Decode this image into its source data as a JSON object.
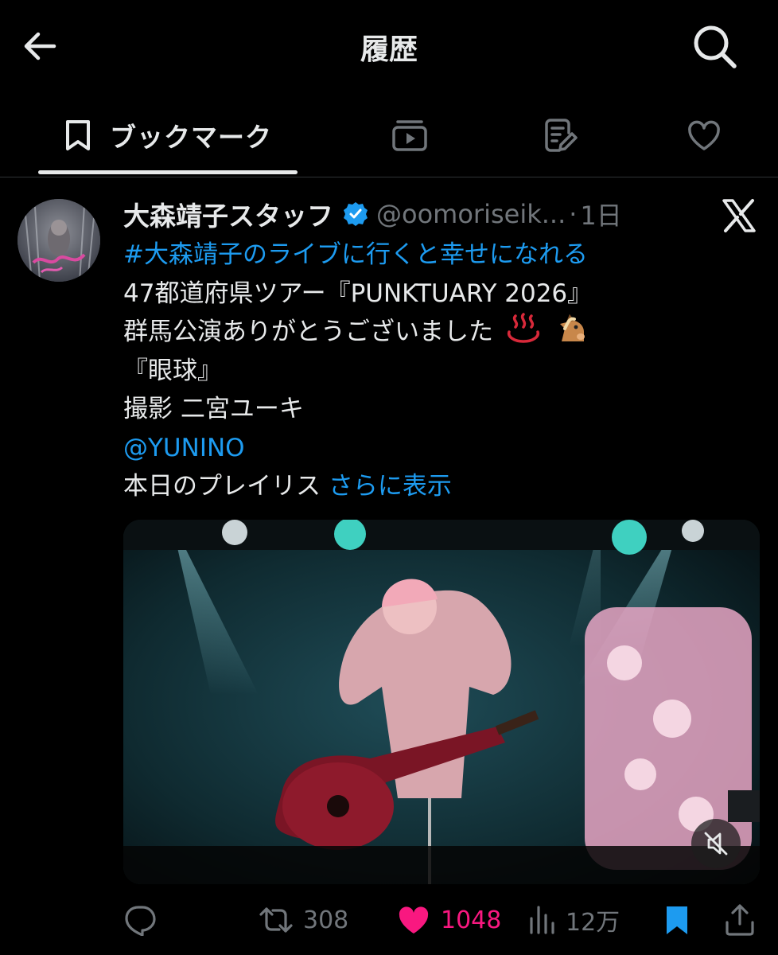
{
  "header": {
    "title": "履歴",
    "back_icon": "arrow-left-icon",
    "search_icon": "search-icon"
  },
  "tabs": [
    {
      "label": "ブックマーク",
      "icon": "bookmark-icon",
      "active": true
    },
    {
      "label": "",
      "icon": "video-icon",
      "active": false
    },
    {
      "label": "",
      "icon": "notes-icon",
      "active": false
    },
    {
      "label": "",
      "icon": "heart-icon",
      "active": false
    }
  ],
  "post": {
    "author_name": "大森靖子スタッフ",
    "verified": true,
    "handle": "@oomoriseik...",
    "separator": "·",
    "time": "1日",
    "lines": {
      "hashtag": "#大森靖子のライブに行くと幸せになれる",
      "line2": "47都道府県ツアー『PUNKTUARY 2026』",
      "line3": "群馬公演ありがとうございました",
      "line4": "『眼球』",
      "line5": "撮影 二宮ユーキ",
      "mention": "@YUNINO",
      "line7": "本日のプレイリス",
      "show_more": "さらに表示"
    },
    "emojis": [
      "hot-springs-emoji",
      "horse-face-emoji"
    ],
    "media": {
      "type": "video",
      "muted": true
    }
  },
  "actions": {
    "reply_count": "",
    "repost_count": "308",
    "like_count": "1048",
    "views_count": "12万",
    "bookmarked": true
  },
  "colors": {
    "background": "#000000",
    "text": "#e7e9ea",
    "secondary": "#71767b",
    "link": "#1d9bf0",
    "like": "#f91880",
    "bookmark": "#1d9bf0"
  }
}
